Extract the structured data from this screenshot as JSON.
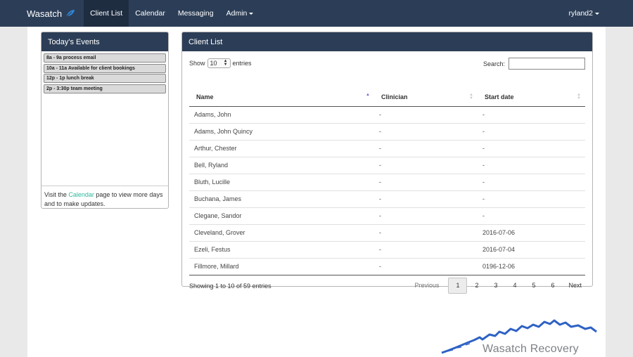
{
  "nav": {
    "brand": "Wasatch",
    "items": [
      "Client List",
      "Calendar",
      "Messaging"
    ],
    "admin": "Admin",
    "user": "ryland2"
  },
  "events_panel": {
    "title": "Today's Events",
    "events": [
      "8a - 9a process email",
      "10a - 11a Available for client bookings",
      "12p - 1p lunch break",
      "2p - 3:30p team meeting"
    ],
    "footer_pre": "Visit the ",
    "footer_link": "Calendar",
    "footer_post": " page to view more days and to make updates."
  },
  "client_panel": {
    "title": "Client List",
    "show_label": "Show",
    "entries_value": "10",
    "entries_label": "entries",
    "search_label": "Search:",
    "search_value": "",
    "columns": [
      "Name",
      "Clinician",
      "Start date"
    ],
    "rows": [
      [
        "Adams, John",
        "-",
        "-"
      ],
      [
        "Adams, John Quincy",
        "-",
        "-"
      ],
      [
        "Arthur, Chester",
        "-",
        "-"
      ],
      [
        "Bell, Ryland",
        "-",
        "-"
      ],
      [
        "Bluth, Lucille",
        "-",
        "-"
      ],
      [
        "Buchana, James",
        "-",
        "-"
      ],
      [
        "Clegane, Sandor",
        "-",
        "-"
      ],
      [
        "Cleveland, Grover",
        "-",
        "2016-07-06"
      ],
      [
        "Ezeli, Festus",
        "-",
        "2016-07-04"
      ],
      [
        "Fillmore, Millard",
        "-",
        "0196-12-06"
      ]
    ],
    "info": "Showing 1 to 10 of 59 entries",
    "pagination": {
      "previous": "Previous",
      "pages": [
        "1",
        "2",
        "3",
        "4",
        "5",
        "6"
      ],
      "current": "1",
      "next": "Next"
    }
  },
  "logo_text": "Wasatch Recovery",
  "colors": {
    "navbar": "#2c3e57",
    "link": "#2fb89b",
    "sort_active": "#6e6bd4"
  }
}
